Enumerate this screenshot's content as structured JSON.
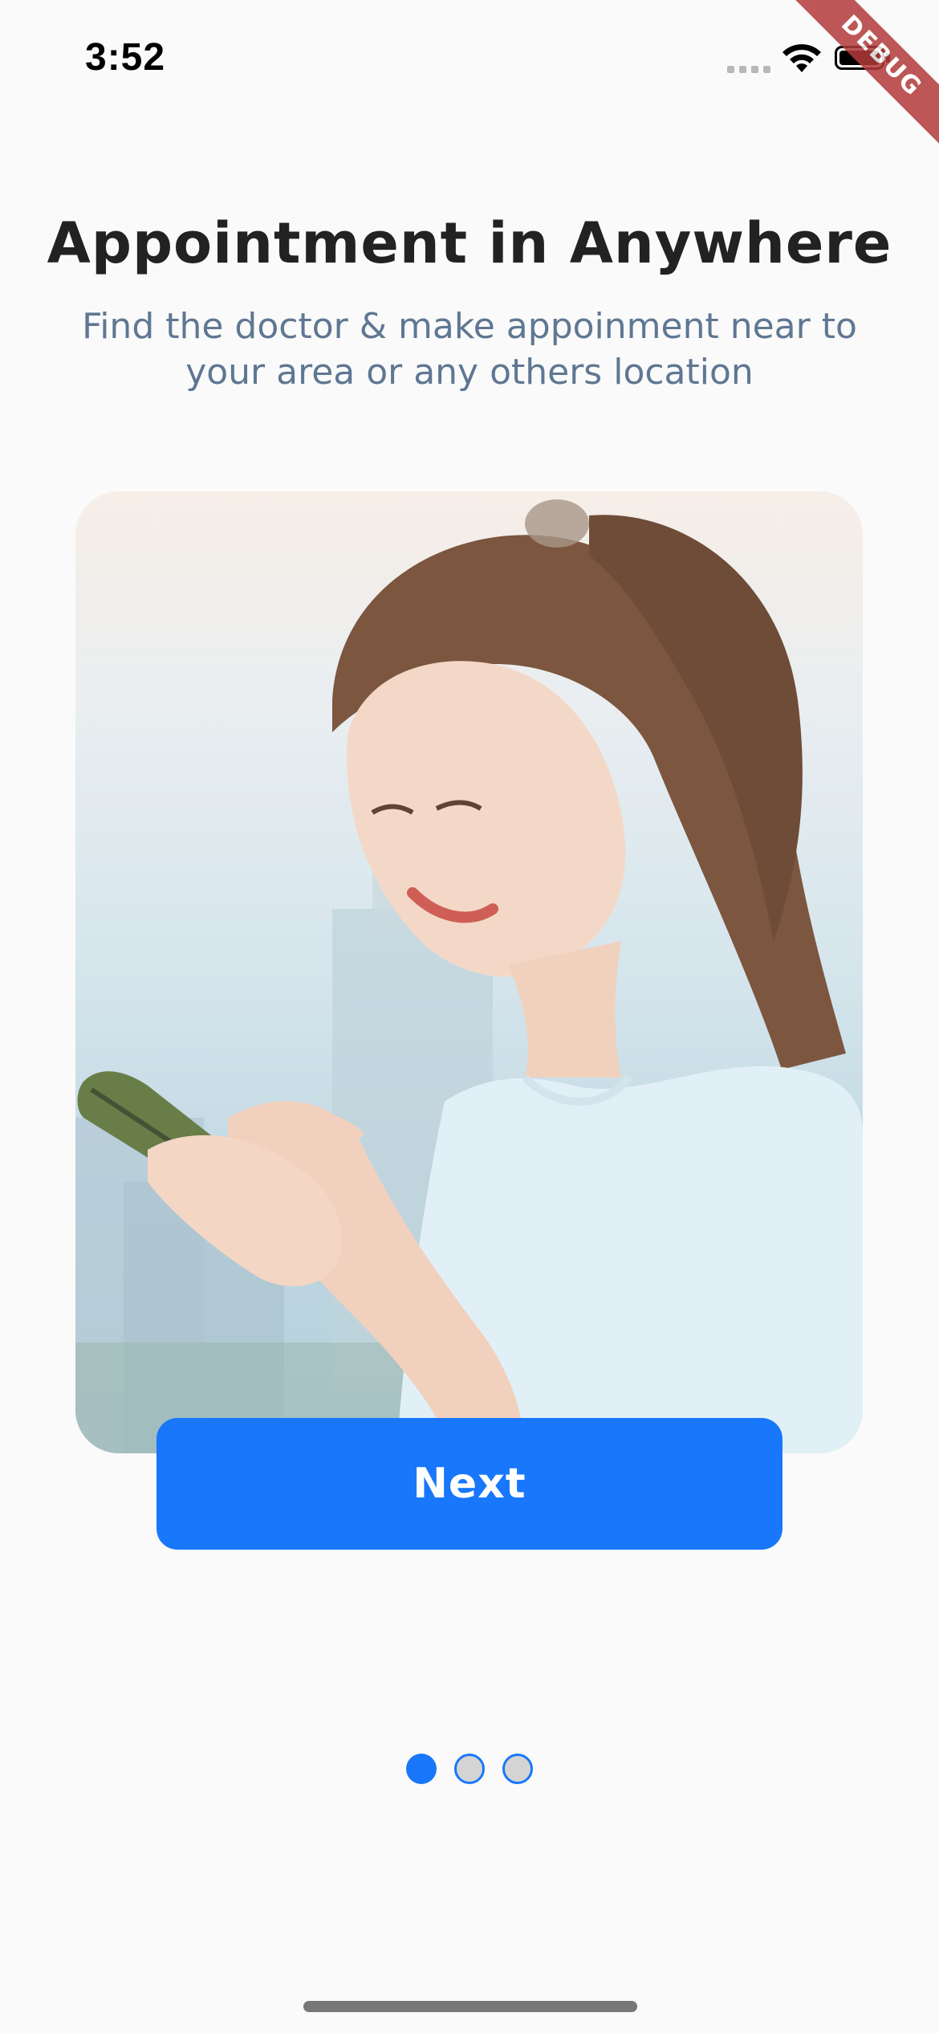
{
  "status_bar": {
    "time": "3:52",
    "icons": [
      "cellular-signal-icon",
      "wifi-icon",
      "battery-icon"
    ]
  },
  "debug_banner": "DEBUG",
  "onboarding": {
    "title": "Appointment in Anywhere",
    "subtitle": "Find the doctor & make appoinment near to your area or any others location",
    "next_label": "Next",
    "pages": 3,
    "current_page": 1
  },
  "colors": {
    "accent": "#1877fb",
    "title": "#222222",
    "subtitle": "#5f7792",
    "background": "#fafafa",
    "debug_ribbon": "#b33a3a"
  }
}
